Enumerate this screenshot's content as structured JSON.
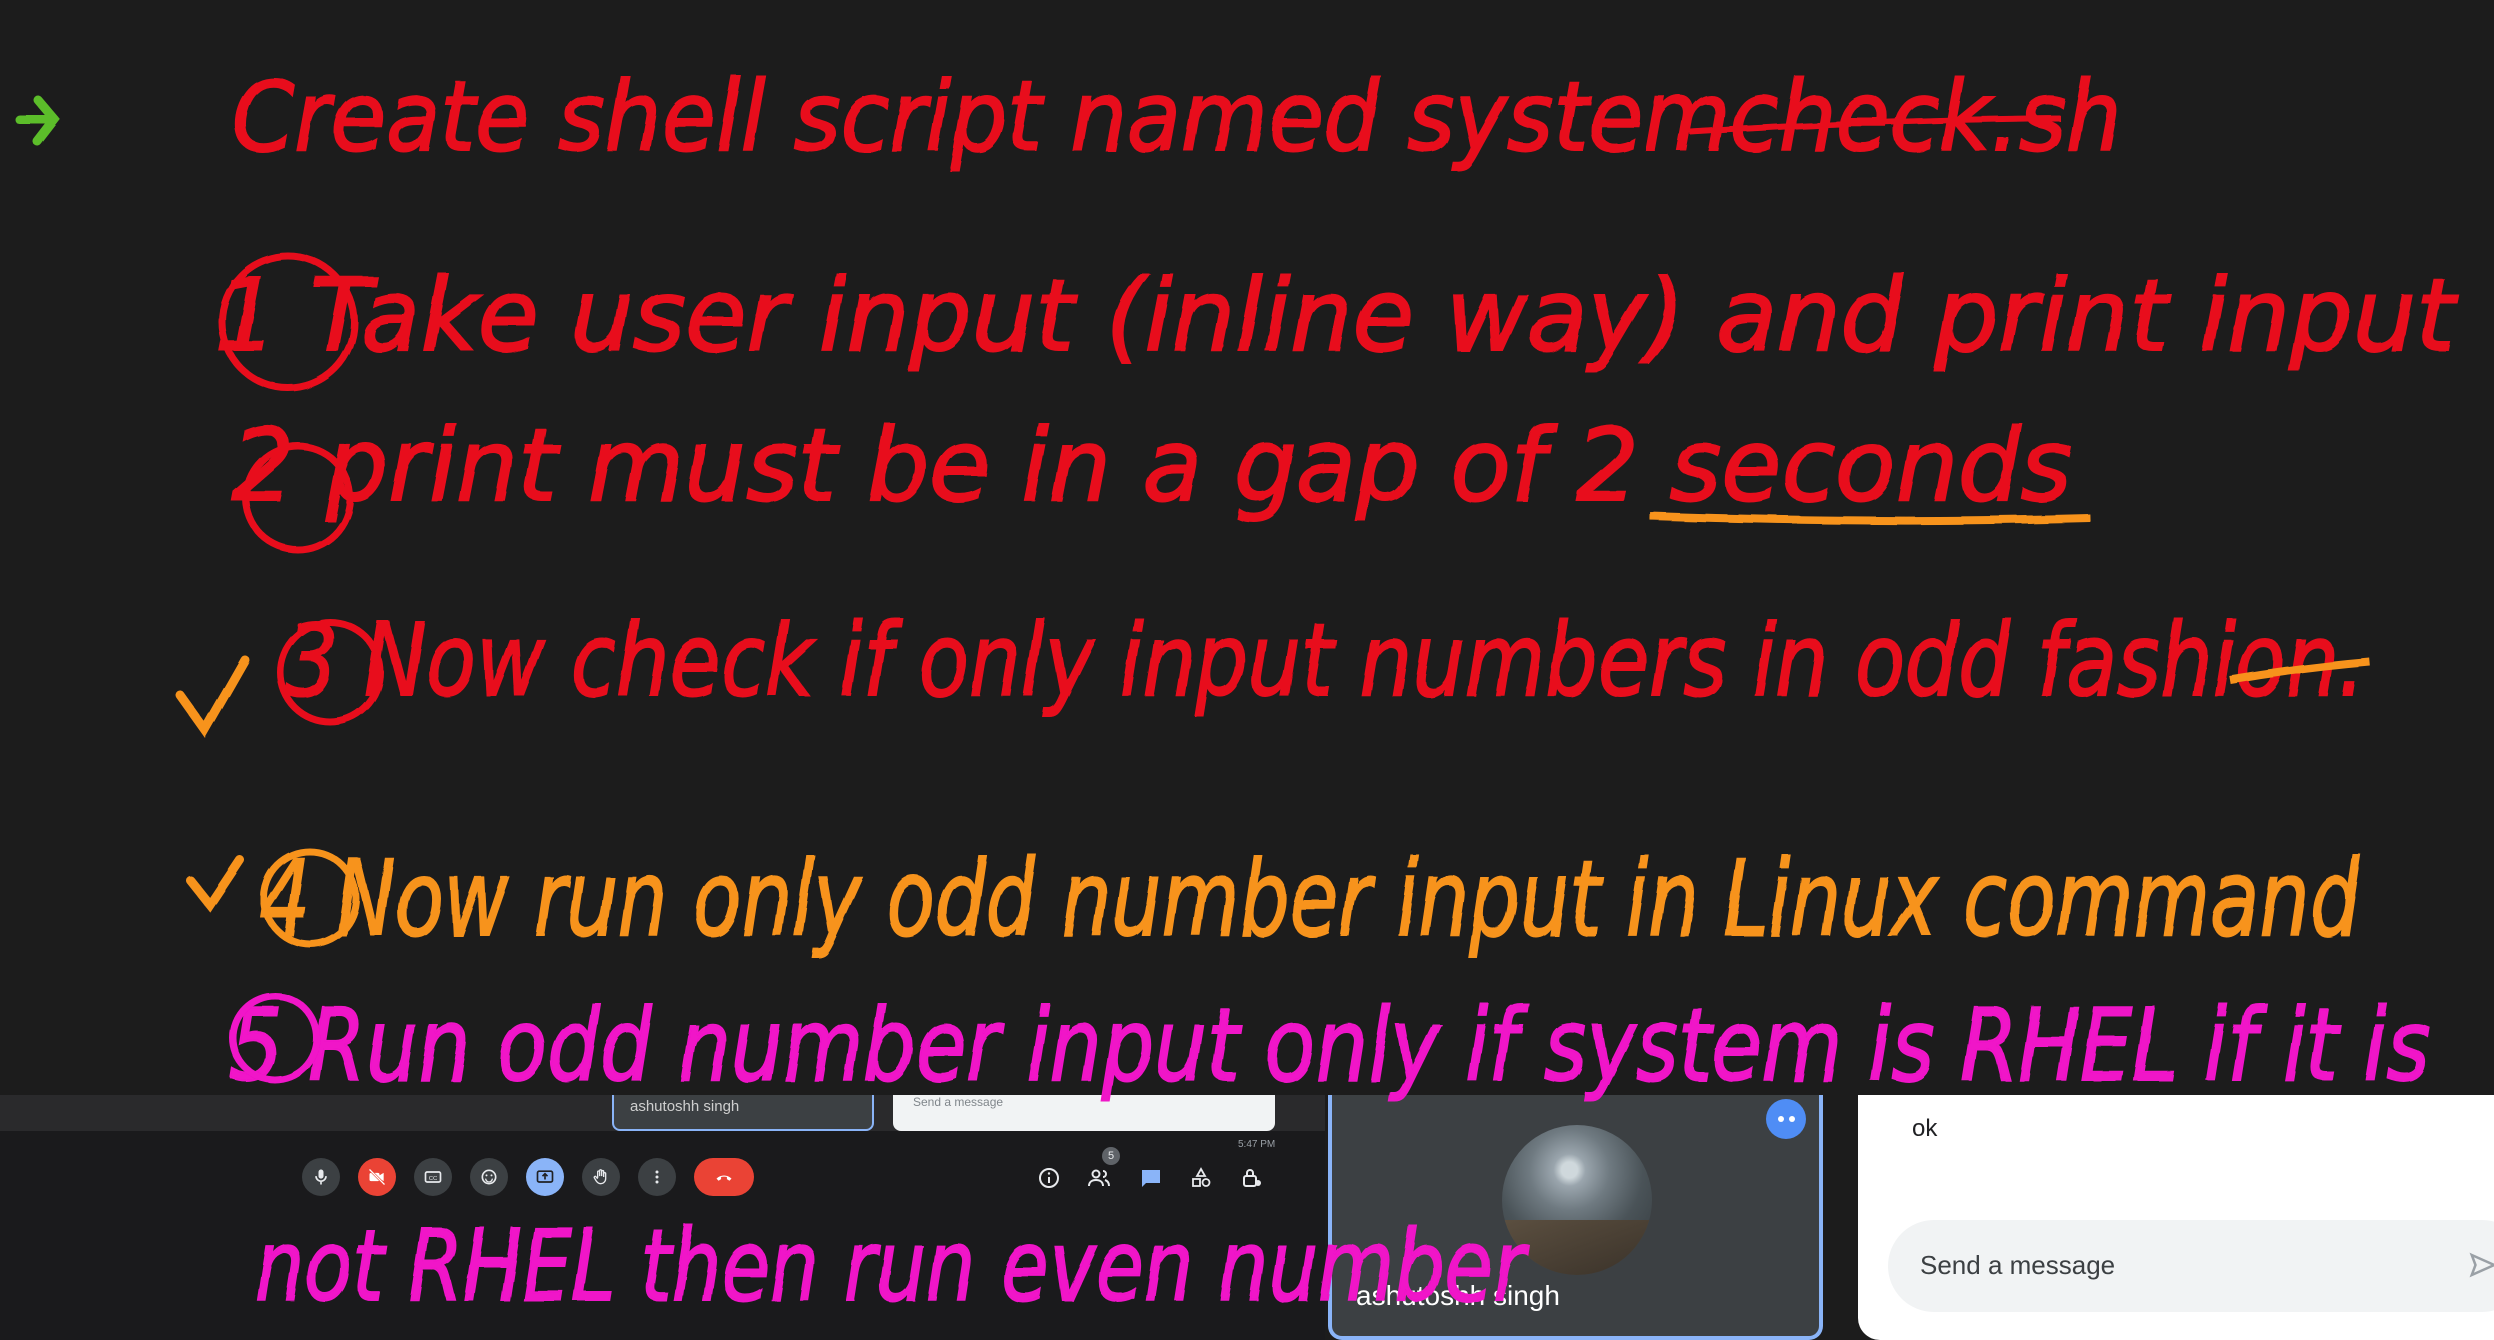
{
  "whiteboard": {
    "title_line": "Create shell script named systemcheck.sh",
    "step_1": "1 Take user input (inline way) and print input",
    "step_2": "2 print must be in a gap of 2 seconds",
    "step_3": "3 Now check if only input numbers in odd fashion.",
    "step_4": "4 Now run only odd number input in Linux command",
    "step_5_line1": "5 Run odd number input only if system is RHEL if it is",
    "step_5_line2": "not RHEL then run even number"
  },
  "meet": {
    "presenter_name": "ashutoshh singh",
    "participant_count": "5",
    "mini_chat_placeholder": "Send a message",
    "mini_time": "5:47 PM"
  },
  "chat": {
    "last_message": "ok",
    "input_placeholder": "Send a message"
  },
  "colors": {
    "board_bg": "#1c1c1c",
    "ink_red": "#e8101c",
    "ink_orange": "#f7931e",
    "ink_magenta": "#f012c8",
    "ink_green": "#5bbd2b",
    "end_call_red": "#ea4335",
    "present_blue": "#8ab4f8"
  },
  "icons": [
    "arrow-icon",
    "check-icon",
    "mic-icon",
    "camera-off-icon",
    "captions-icon",
    "emoji-icon",
    "present-icon",
    "raise-hand-icon",
    "more-options-icon",
    "end-call-icon",
    "info-icon",
    "people-icon",
    "chat-icon",
    "activities-icon",
    "host-controls-icon",
    "send-icon"
  ]
}
